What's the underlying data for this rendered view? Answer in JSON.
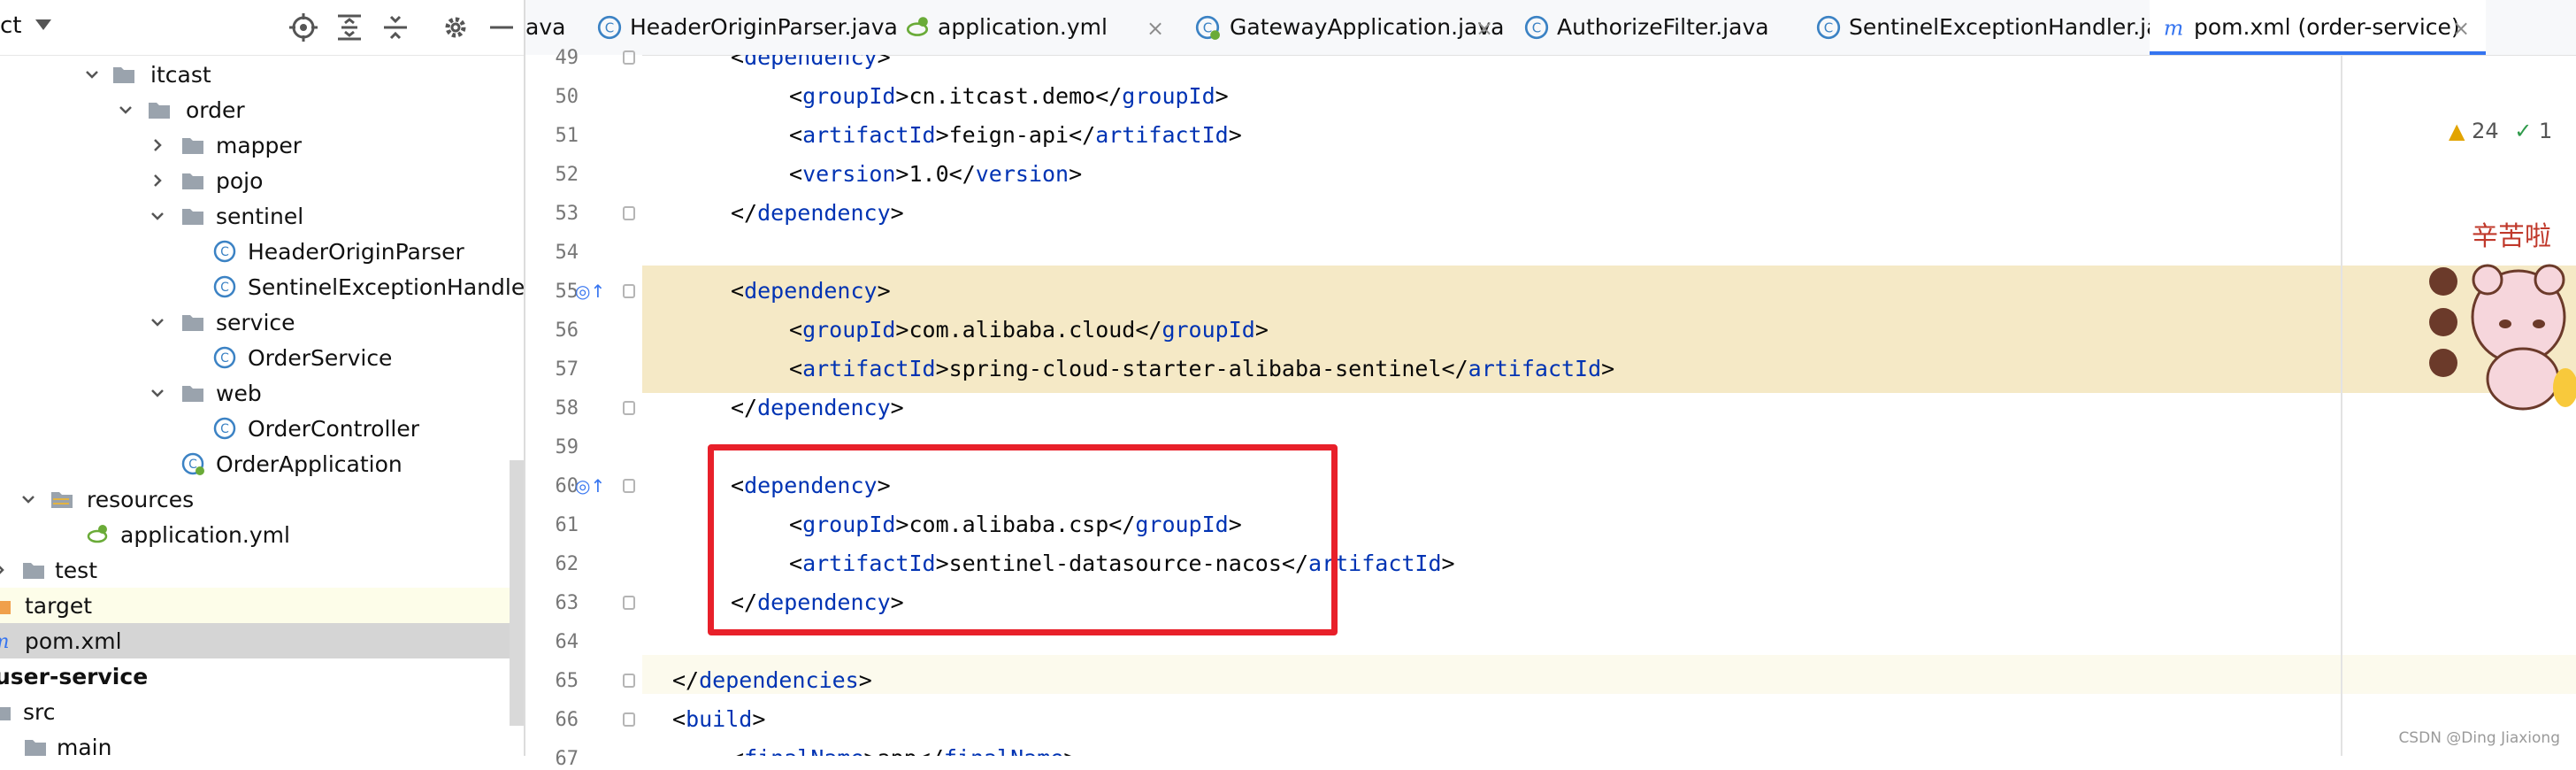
{
  "project_panel": {
    "title": "ct",
    "toolbar": [
      "target-icon",
      "expand-all-icon",
      "collapse-all-icon",
      "gear-icon",
      "minimize-icon"
    ],
    "tree": [
      {
        "label": "itcast",
        "icon": "folder-icon",
        "expanded": true
      },
      {
        "label": "order",
        "icon": "folder-icon",
        "expanded": true
      },
      {
        "label": "mapper",
        "icon": "folder-icon",
        "expanded": false
      },
      {
        "label": "pojo",
        "icon": "folder-icon",
        "expanded": false
      },
      {
        "label": "sentinel",
        "icon": "folder-icon",
        "expanded": true
      },
      {
        "label": "HeaderOriginParser",
        "icon": "class-icon"
      },
      {
        "label": "SentinelExceptionHandle",
        "icon": "class-icon"
      },
      {
        "label": "service",
        "icon": "folder-icon",
        "expanded": true
      },
      {
        "label": "OrderService",
        "icon": "class-icon"
      },
      {
        "label": "web",
        "icon": "folder-icon",
        "expanded": true
      },
      {
        "label": "OrderController",
        "icon": "class-icon"
      },
      {
        "label": "OrderApplication",
        "icon": "spring-class-icon"
      },
      {
        "label": "resources",
        "icon": "resources-folder-icon",
        "expanded": true
      },
      {
        "label": "application.yml",
        "icon": "yml-file-icon"
      },
      {
        "label": "test",
        "icon": "folder-icon",
        "expanded": false
      },
      {
        "label": "target",
        "icon": "orange-folder-icon",
        "expanded": false
      },
      {
        "label": "pom.xml",
        "icon": "maven-icon"
      },
      {
        "label": "user-service",
        "icon": "module-icon"
      },
      {
        "label": "src",
        "icon": "folder-icon"
      },
      {
        "label": "main",
        "icon": "folder-icon"
      }
    ]
  },
  "tabs": [
    {
      "label": "ava",
      "icon": ""
    },
    {
      "label": "HeaderOriginParser.java",
      "icon": "class-icon"
    },
    {
      "label": "application.yml",
      "icon": "yml-file-icon"
    },
    {
      "label": "GatewayApplication.java",
      "icon": "spring-class-icon"
    },
    {
      "label": "AuthorizeFilter.java",
      "icon": "class-icon"
    },
    {
      "label": "SentinelExceptionHandler.java",
      "icon": "class-icon"
    },
    {
      "label": "pom.xml (order-service)",
      "icon": "maven-icon"
    }
  ],
  "editor": {
    "warnings": "24",
    "ok": "1",
    "line_numbers": [
      "49",
      "50",
      "51",
      "52",
      "53",
      "54",
      "55",
      "56",
      "57",
      "58",
      "59",
      "60",
      "61",
      "62",
      "63",
      "64",
      "65",
      "66",
      "67"
    ],
    "code": [
      {
        "indent": 1,
        "text": "<dependency>"
      },
      {
        "indent": 2,
        "tag": "groupId",
        "value": "cn.itcast.demo"
      },
      {
        "indent": 2,
        "tag": "artifactId",
        "value": "feign-api"
      },
      {
        "indent": 2,
        "tag": "version",
        "value": "1.0"
      },
      {
        "indent": 1,
        "close": "dependency"
      },
      {
        "indent": 0,
        "text": ""
      },
      {
        "indent": 1,
        "open": "dependency"
      },
      {
        "indent": 2,
        "tag": "groupId",
        "value": "com.alibaba.cloud"
      },
      {
        "indent": 2,
        "tag": "artifactId",
        "value": "spring-cloud-starter-alibaba-sentinel"
      },
      {
        "indent": 1,
        "close": "dependency"
      },
      {
        "indent": 0,
        "text": ""
      },
      {
        "indent": 1,
        "open": "dependency"
      },
      {
        "indent": 2,
        "tag": "groupId",
        "value": "com.alibaba.csp"
      },
      {
        "indent": 2,
        "tag": "artifactId",
        "value": "sentinel-datasource-nacos"
      },
      {
        "indent": 1,
        "close": "dependency"
      },
      {
        "indent": 0,
        "text": ""
      },
      {
        "indent": 0,
        "close": "dependencies"
      },
      {
        "indent": 0,
        "open": "build"
      },
      {
        "indent": 1,
        "tag": "finalName",
        "value": "app"
      }
    ]
  },
  "sticker_text": "辛苦啦",
  "watermark": "CSDN @Ding Jiaxiong",
  "colors": {
    "accent": "#3574f0",
    "tag": "#0033b3",
    "highlight_band": "#f5e9c6",
    "red_box": "#e8202a"
  }
}
